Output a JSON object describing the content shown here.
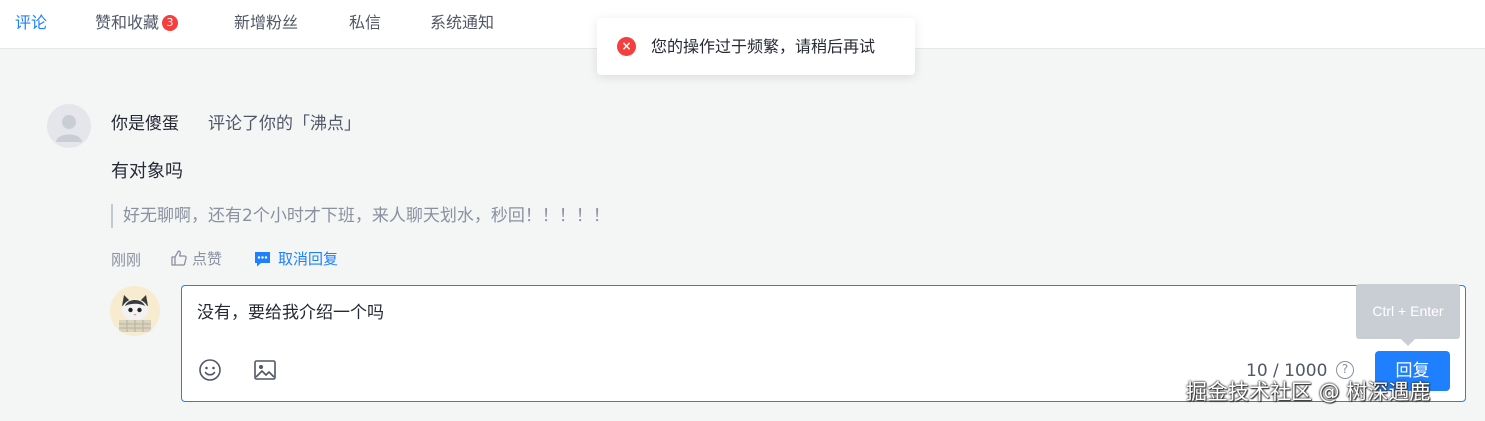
{
  "nav": {
    "tabs": [
      {
        "label": "评论",
        "active": true
      },
      {
        "label": "赞和收藏",
        "badge": "3"
      },
      {
        "label": "新增粉丝"
      },
      {
        "label": "私信"
      },
      {
        "label": "系统通知"
      }
    ]
  },
  "toast": {
    "message": "您的操作过于频繁，请稍后再试",
    "icon": "error-icon",
    "icon_glyph": "×"
  },
  "notification": {
    "username": "你是傻蛋",
    "action": "评论了你的「沸点」",
    "comment": "有对象吗",
    "quote": "好无聊啊，还有2个小时才下班，来人聊天划水，秒回！！！！！",
    "time": "刚刚",
    "like_label": "点赞",
    "reply_toggle_label": "取消回复"
  },
  "reply_editor": {
    "value": "没有，要给我介绍一个吗",
    "counter": "10 / 1000",
    "help_glyph": "?",
    "submit_label": "回复",
    "shortcut_tooltip": "Ctrl + Enter"
  },
  "watermark": "掘金技术社区 @ 树深遇鹿",
  "colors": {
    "accent": "#1e80ff",
    "error": "#f53f3f",
    "text_primary": "#252933",
    "text_muted": "#8a919f"
  }
}
